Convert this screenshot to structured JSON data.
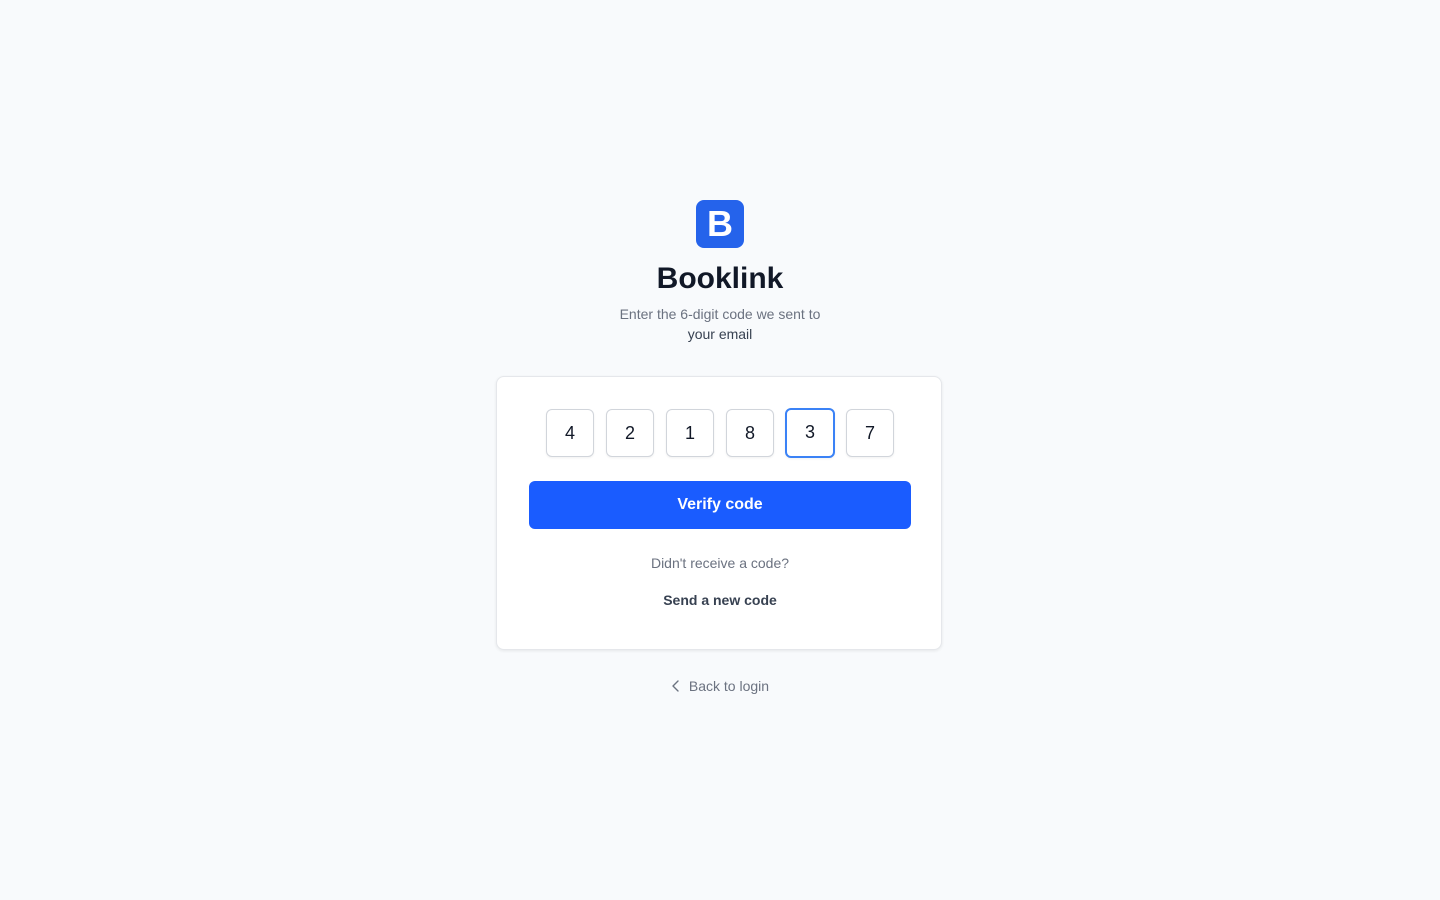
{
  "brand": {
    "logo_letter": "B",
    "app_name": "Booklink",
    "accent_color": "#2563eb"
  },
  "header": {
    "instruction": "Enter the 6-digit code we sent to",
    "destination": "your email"
  },
  "verification": {
    "digits": [
      "4",
      "2",
      "1",
      "8",
      "3",
      "7"
    ],
    "focused_index": 4,
    "verify_label": "Verify code",
    "no_code_prompt": "Didn't receive a code?",
    "resend_label": "Send a new code"
  },
  "footer": {
    "back_label": "Back to login",
    "back_icon": "chevron-left-icon"
  }
}
